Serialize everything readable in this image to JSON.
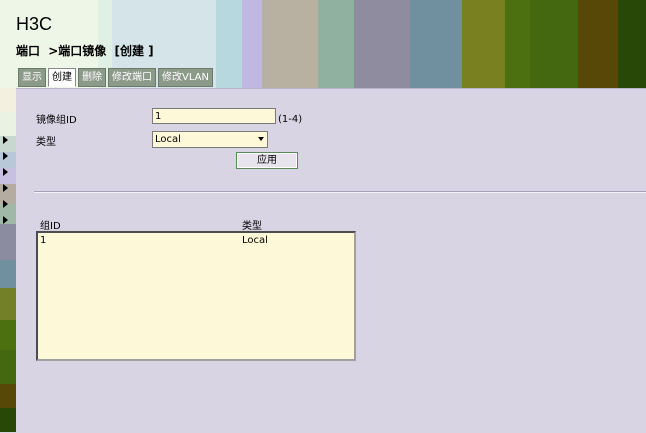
{
  "header": {
    "brand": "H3C",
    "breadcrumb": [
      "端口",
      ">端口镜像",
      "[创建 ]"
    ],
    "stripe_colors": [
      "#eef6e8",
      "#e0f0e4",
      "#d4e4e8",
      "#b8d8e0",
      "#c0b8e0",
      "#b8b0a0",
      "#90b0a0",
      "#908ca0",
      "#7090a0",
      "#788020",
      "#4c7010",
      "#446810",
      "#584808",
      "#284808"
    ]
  },
  "tabs": [
    {
      "label": "显示",
      "active": false
    },
    {
      "label": "创建",
      "active": true
    },
    {
      "label": "删除",
      "active": false
    },
    {
      "label": "修改端口",
      "active": false
    },
    {
      "label": "修改VLAN",
      "active": false
    }
  ],
  "leftnav": {
    "colors": [
      "#f4f0e0",
      "#eaf2e4",
      "#c8d8d0",
      "#b8c8d8",
      "#c8c0e0",
      "#b4aca0",
      "#a0b8a8",
      "#8c8ca0",
      "#7090a0",
      "#748028",
      "#4c7010",
      "#446810",
      "#584808",
      "#284808"
    ]
  },
  "form": {
    "id_label": "镜像组ID",
    "id_value": "1",
    "id_hint": "(1-4)",
    "type_label": "类型",
    "type_value": "Local",
    "apply_label": "应用"
  },
  "list": {
    "col_id": "组ID",
    "col_type": "类型",
    "rows": [
      {
        "id": "1",
        "type": "Local"
      }
    ]
  }
}
